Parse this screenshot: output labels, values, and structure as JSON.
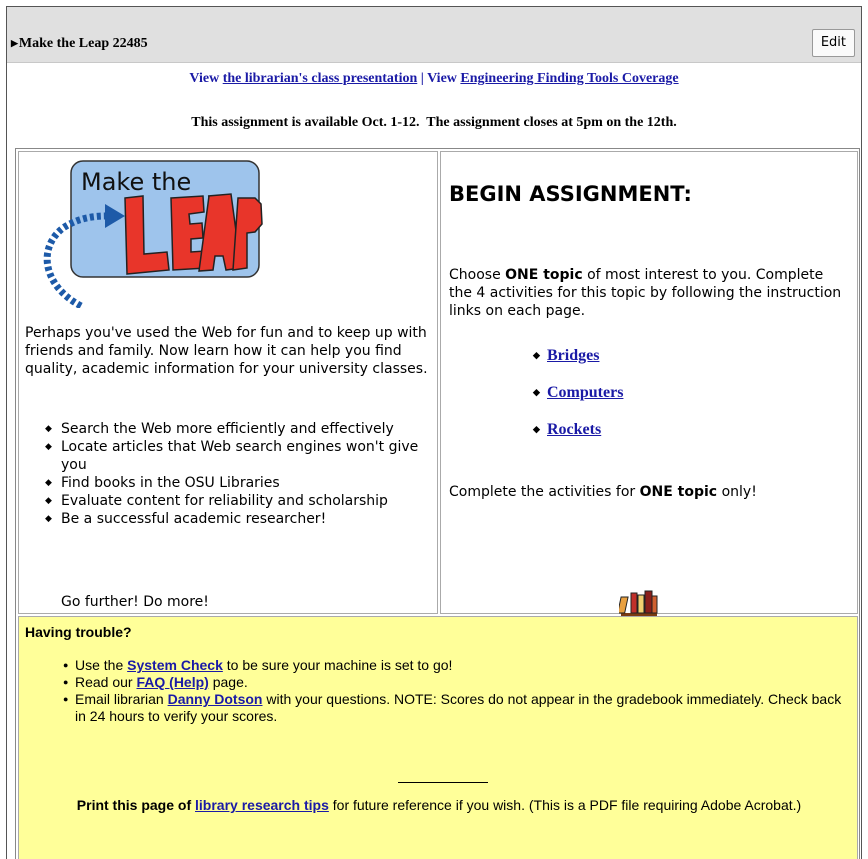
{
  "header": {
    "title": "Make the Leap 22485",
    "edit_label": "Edit"
  },
  "links_line": {
    "prefix": "View ",
    "presentation_link": "the librarian's class presentation",
    "separator": " | View ",
    "coverage_link": "Engineering Finding Tools Coverage"
  },
  "availability": "This assignment is available Oct. 1-12.  The assignment closes at 5pm on the 12th.",
  "logo": {
    "line1": "Make the",
    "line2": "LEAP"
  },
  "intro": {
    "text": "Perhaps you've used the Web for fun and to keep up with friends and family. Now learn how it can help you find quality, academic information for your university classes.",
    "benefits": [
      "Search the Web more efficiently and effectively",
      "Locate articles that Web search engines won't give you",
      "Find books in the OSU Libraries",
      "Evaluate content for reliability and scholarship",
      "Be a successful academic researcher!"
    ],
    "go_further": "Go further! Do more!"
  },
  "assignment": {
    "heading": "BEGIN ASSIGNMENT:",
    "choose_prefix": "Choose ",
    "choose_bold": "ONE topic",
    "choose_suffix": " of most interest to you. Complete the 4 activities for this topic by following the instruction links on each page.",
    "topics": [
      "Bridges",
      "Computers",
      "Rockets"
    ],
    "complete_prefix": "Complete the activities for ",
    "complete_bold": "ONE topic",
    "complete_suffix": " only!"
  },
  "trouble": {
    "title": "Having trouble?",
    "item1_prefix": "Use the ",
    "item1_link": "System Check",
    "item1_suffix": " to be sure your machine is set to go!",
    "item2_prefix": "Read our ",
    "item2_link": "FAQ (Help)",
    "item2_suffix": " page.",
    "item3_prefix": "Email librarian ",
    "item3_link": "Danny Dotson",
    "item3_suffix": " with your questions. NOTE: Scores do not appear in the gradebook immediately. Check back in 24 hours to verify your scores.",
    "print_prefix": "Print this page of ",
    "print_link": "library research tips",
    "print_suffix": " for future reference if you wish. (This is a PDF file requiring Adobe Acrobat.)"
  },
  "colors": {
    "header_bg": "#e0e0e0",
    "link": "#1a1aa6",
    "trouble_bg": "#ffff99",
    "logo_bg": "#9ec4ec",
    "logo_letters": "#e8352a",
    "logo_arrow": "#1d5aa8"
  },
  "icons": [
    "triangle-expand-icon",
    "books-icon",
    "leap-arrow-icon"
  ]
}
